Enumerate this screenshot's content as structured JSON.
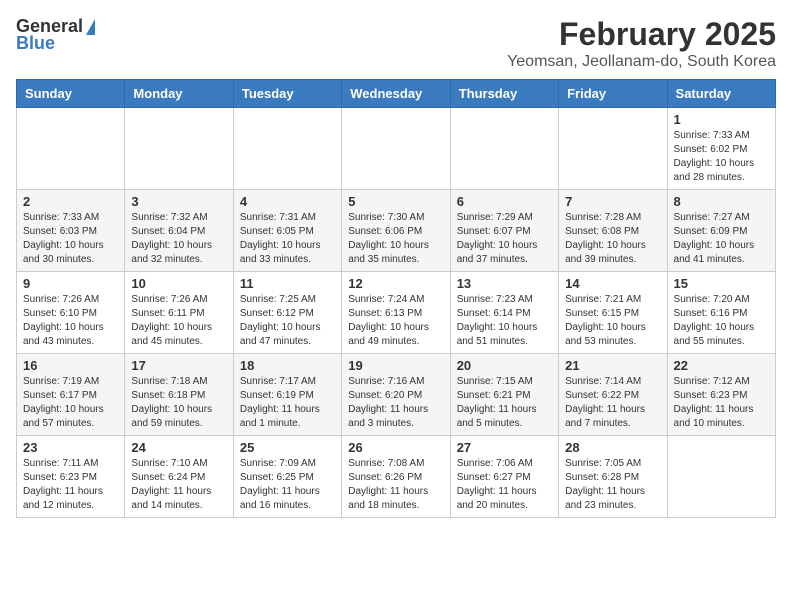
{
  "header": {
    "logo_general": "General",
    "logo_blue": "Blue",
    "title": "February 2025",
    "subtitle": "Yeomsan, Jeollanam-do, South Korea"
  },
  "days_of_week": [
    "Sunday",
    "Monday",
    "Tuesday",
    "Wednesday",
    "Thursday",
    "Friday",
    "Saturday"
  ],
  "weeks": [
    [
      {
        "day": "",
        "info": ""
      },
      {
        "day": "",
        "info": ""
      },
      {
        "day": "",
        "info": ""
      },
      {
        "day": "",
        "info": ""
      },
      {
        "day": "",
        "info": ""
      },
      {
        "day": "",
        "info": ""
      },
      {
        "day": "1",
        "info": "Sunrise: 7:33 AM\nSunset: 6:02 PM\nDaylight: 10 hours and 28 minutes."
      }
    ],
    [
      {
        "day": "2",
        "info": "Sunrise: 7:33 AM\nSunset: 6:03 PM\nDaylight: 10 hours and 30 minutes."
      },
      {
        "day": "3",
        "info": "Sunrise: 7:32 AM\nSunset: 6:04 PM\nDaylight: 10 hours and 32 minutes."
      },
      {
        "day": "4",
        "info": "Sunrise: 7:31 AM\nSunset: 6:05 PM\nDaylight: 10 hours and 33 minutes."
      },
      {
        "day": "5",
        "info": "Sunrise: 7:30 AM\nSunset: 6:06 PM\nDaylight: 10 hours and 35 minutes."
      },
      {
        "day": "6",
        "info": "Sunrise: 7:29 AM\nSunset: 6:07 PM\nDaylight: 10 hours and 37 minutes."
      },
      {
        "day": "7",
        "info": "Sunrise: 7:28 AM\nSunset: 6:08 PM\nDaylight: 10 hours and 39 minutes."
      },
      {
        "day": "8",
        "info": "Sunrise: 7:27 AM\nSunset: 6:09 PM\nDaylight: 10 hours and 41 minutes."
      }
    ],
    [
      {
        "day": "9",
        "info": "Sunrise: 7:26 AM\nSunset: 6:10 PM\nDaylight: 10 hours and 43 minutes."
      },
      {
        "day": "10",
        "info": "Sunrise: 7:26 AM\nSunset: 6:11 PM\nDaylight: 10 hours and 45 minutes."
      },
      {
        "day": "11",
        "info": "Sunrise: 7:25 AM\nSunset: 6:12 PM\nDaylight: 10 hours and 47 minutes."
      },
      {
        "day": "12",
        "info": "Sunrise: 7:24 AM\nSunset: 6:13 PM\nDaylight: 10 hours and 49 minutes."
      },
      {
        "day": "13",
        "info": "Sunrise: 7:23 AM\nSunset: 6:14 PM\nDaylight: 10 hours and 51 minutes."
      },
      {
        "day": "14",
        "info": "Sunrise: 7:21 AM\nSunset: 6:15 PM\nDaylight: 10 hours and 53 minutes."
      },
      {
        "day": "15",
        "info": "Sunrise: 7:20 AM\nSunset: 6:16 PM\nDaylight: 10 hours and 55 minutes."
      }
    ],
    [
      {
        "day": "16",
        "info": "Sunrise: 7:19 AM\nSunset: 6:17 PM\nDaylight: 10 hours and 57 minutes."
      },
      {
        "day": "17",
        "info": "Sunrise: 7:18 AM\nSunset: 6:18 PM\nDaylight: 10 hours and 59 minutes."
      },
      {
        "day": "18",
        "info": "Sunrise: 7:17 AM\nSunset: 6:19 PM\nDaylight: 11 hours and 1 minute."
      },
      {
        "day": "19",
        "info": "Sunrise: 7:16 AM\nSunset: 6:20 PM\nDaylight: 11 hours and 3 minutes."
      },
      {
        "day": "20",
        "info": "Sunrise: 7:15 AM\nSunset: 6:21 PM\nDaylight: 11 hours and 5 minutes."
      },
      {
        "day": "21",
        "info": "Sunrise: 7:14 AM\nSunset: 6:22 PM\nDaylight: 11 hours and 7 minutes."
      },
      {
        "day": "22",
        "info": "Sunrise: 7:12 AM\nSunset: 6:23 PM\nDaylight: 11 hours and 10 minutes."
      }
    ],
    [
      {
        "day": "23",
        "info": "Sunrise: 7:11 AM\nSunset: 6:23 PM\nDaylight: 11 hours and 12 minutes."
      },
      {
        "day": "24",
        "info": "Sunrise: 7:10 AM\nSunset: 6:24 PM\nDaylight: 11 hours and 14 minutes."
      },
      {
        "day": "25",
        "info": "Sunrise: 7:09 AM\nSunset: 6:25 PM\nDaylight: 11 hours and 16 minutes."
      },
      {
        "day": "26",
        "info": "Sunrise: 7:08 AM\nSunset: 6:26 PM\nDaylight: 11 hours and 18 minutes."
      },
      {
        "day": "27",
        "info": "Sunrise: 7:06 AM\nSunset: 6:27 PM\nDaylight: 11 hours and 20 minutes."
      },
      {
        "day": "28",
        "info": "Sunrise: 7:05 AM\nSunset: 6:28 PM\nDaylight: 11 hours and 23 minutes."
      },
      {
        "day": "",
        "info": ""
      }
    ]
  ]
}
